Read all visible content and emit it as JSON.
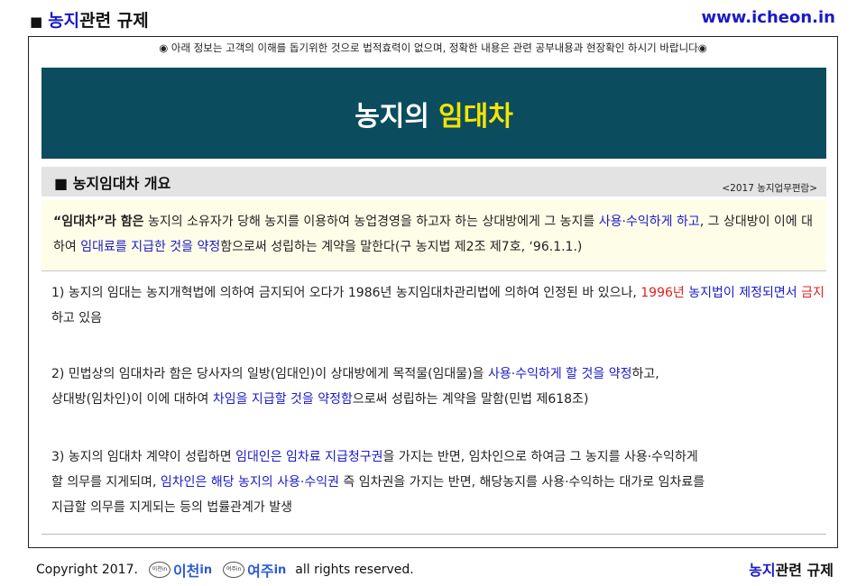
{
  "header": {
    "title_accent": "농지",
    "title_rest": "관련 규제",
    "site": "www.icheon.in"
  },
  "notice": "◉ 아래 정보는 고객의 이해를 돕기위한 것으로 법적효력이 없으며, 정확한 내용은 관련 공부내용과 현장확인 하시기 바랍니다◉",
  "banner": {
    "title_main": "농지의",
    "title_highlight": "임대차"
  },
  "section": {
    "title": "■ 농지임대차 개요",
    "source": "<2017 농지업무편람>"
  },
  "definition": {
    "p1": "“임대차”라 함은",
    "p2": " 농지의 소유자가 당해 농지를 이용하여 농업경영을 하고자 하는 상대방에게 그 농지를 ",
    "p3": "사용·수익하게 하고",
    "p4": ", 그 상대방이 이에 대하여 ",
    "p5": "임대료를 지급한 것을 약정",
    "p6": "함으로써 성립하는  계약을  말한다(구  농지법  제2조  제7호,  ‘96.1.1.)"
  },
  "items": [
    {
      "a": "1) 농지의 임대는 농지개혁법에 의하여 금지되어 오다가 1986년 농지임대차관리법에 의하여 인정된 바 있으나, ",
      "b": "1996년",
      "c": " 농지법이 제정되면서 ",
      "d": "금지",
      "e": "하고 있음"
    },
    {
      "a": "2) 민법상의 임대차라 함은 당사자의 일방(임대인)이 상대방에게 목적물(임대물)을 ",
      "b": "사용·수익하게 할 것을 약정",
      "c": "하고,",
      "d": "상대방(임차인)이 이에 대하여 ",
      "e": "차임을 지급할 것을 약정함",
      "f": "으로써 성립하는 계약을 말함(민법 제618조)"
    },
    {
      "a": "3) 농지의 임대차 계약이 성립하면 ",
      "b": "임대인은 임차료 지급청구권",
      "c": "을 가지는 반면, 임차인으로 하여금 그 농지를 사용·수익하게",
      "d": "할 의무를 지게되며, ",
      "e": "임차인은 해당 농지의 사용·수익권",
      "f": " 즉 임차권을 가지는 반면, 해당농지를 사용·수익하는 대가로 임차료를",
      "g": "지급할 의무를 지게되는 등의 법률관계가 발생"
    }
  ],
  "footer": {
    "copyright": "Copyright 2017.",
    "logo1_mark": "이천in",
    "logo1": "이천",
    "logo1_suffix": "in",
    "logo2_mark": "여주in",
    "logo2": "여주",
    "logo2_suffix": "in",
    "rights": "all rights reserved.",
    "title_accent": "농지",
    "title_rest": "관련 규제"
  },
  "colors": {
    "banner_bg": "#0b4d5e",
    "highlight": "#f5e500",
    "link_blue": "#1a1ac8",
    "emphasis_red": "#e02020"
  }
}
